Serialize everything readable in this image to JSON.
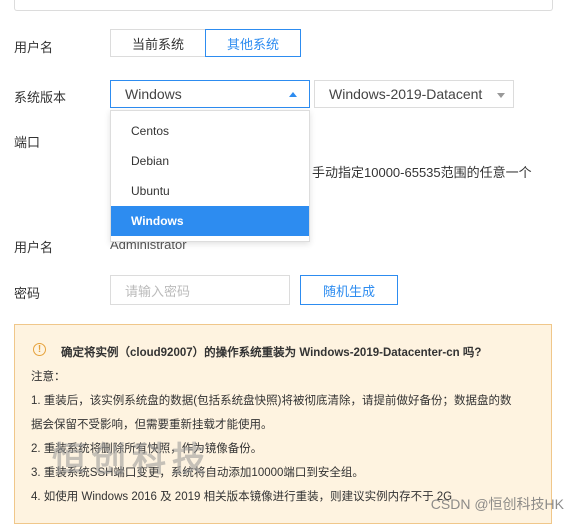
{
  "form": {
    "username_label": "用户名",
    "system_tabs": [
      "当前系统",
      "其他系统"
    ],
    "os_version_label": "系统版本",
    "os_family_selected": "Windows",
    "os_family_options": [
      "Centos",
      "Debian",
      "Ubuntu",
      "Windows"
    ],
    "os_image_selected": "Windows-2019-Datacent",
    "port_label": "端口",
    "port_hint": "手动指定10000-65535范围的任意一个",
    "account_label": "用户名",
    "account_value": "Administrator",
    "password_label": "密码",
    "password_placeholder": "请输入密码",
    "random_button": "随机生成"
  },
  "warning": {
    "title": "确定将实例（cloud92007）的操作系统重装为 Windows-2019-Datacenter-cn 吗?",
    "note_label": "注意：",
    "lines": [
      "1. 重装后，该实例系统盘的数据(包括系统盘快照)将被彻底清除，请提前做好备份；数据盘的数",
      "据会保留不受影响，但需要重新挂载才能使用。",
      "2. 重装系统将删除所有快照，作为镜像备份。",
      "3. 重装系统SSH端口变更，系统将自动添加10000端口到安全组。",
      "4. 如使用 Windows 2016 及 2019 相关版本镜像进行重装，则建议实例内存不于 2G"
    ]
  },
  "watermark": {
    "center": "恒创科技",
    "corner": "CSDN @恒创科技HK"
  },
  "colors": {
    "accent": "#2d8cf0",
    "warning_bg": "#fef3e0",
    "warning_border": "#f0c78a",
    "warning_icon": "#e6a23c"
  }
}
